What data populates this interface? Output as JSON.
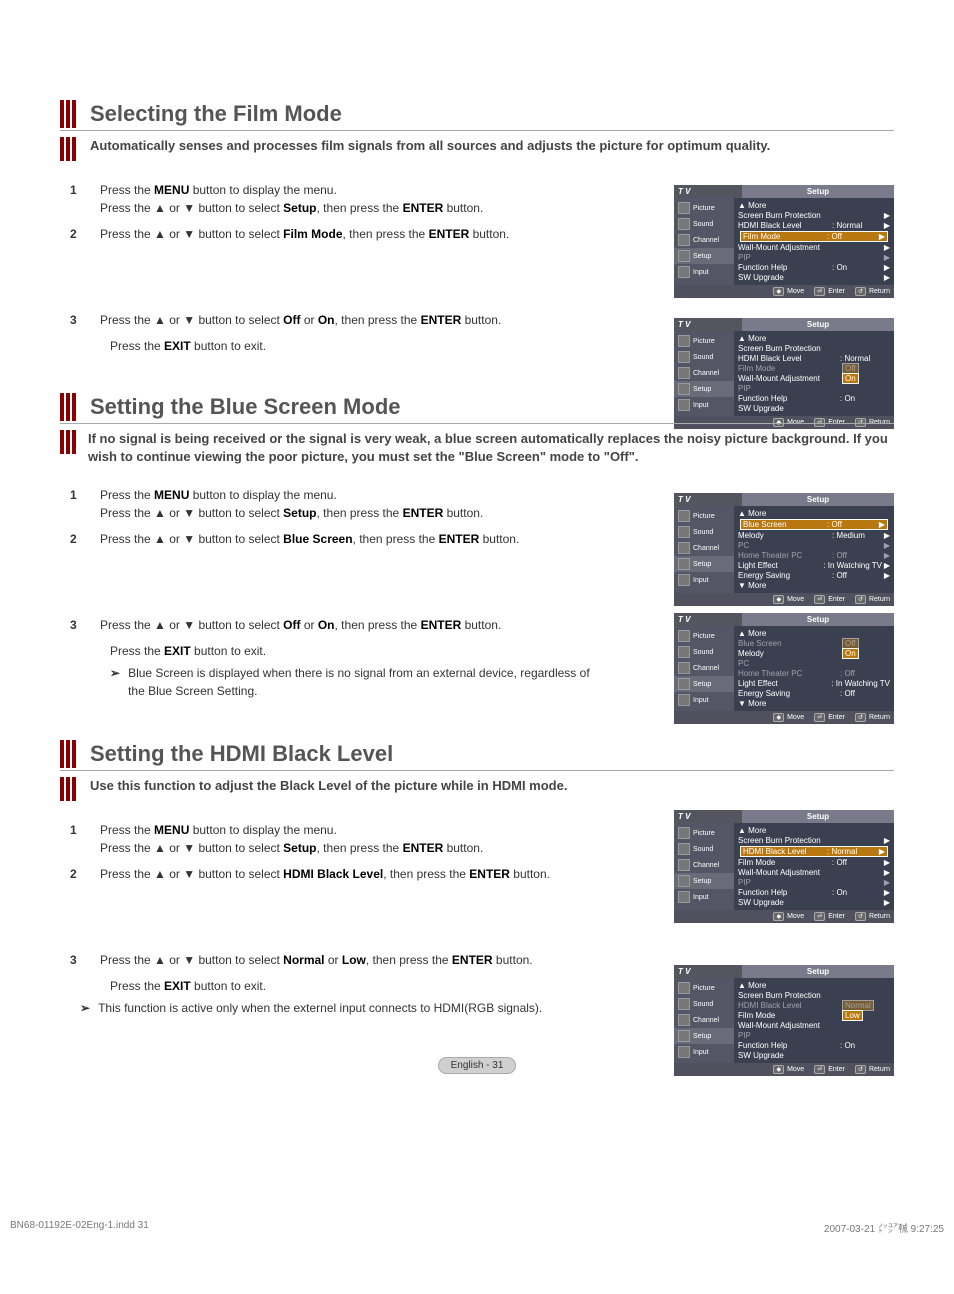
{
  "sec1": {
    "title": "Selecting the Film Mode",
    "subtitle": "Automatically senses and processes film signals from all sources and adjusts the picture for optimum quality.",
    "step1a": "Press the ",
    "step1a_b": "MENU",
    "step1a_c": " button to display the menu.",
    "step1b": "Press the ▲ or ▼ button to select ",
    "step1b_b": "Setup",
    "step1b_c": ", then press the ",
    "step1b_d": "ENTER",
    "step1b_e": " button.",
    "step2a": "Press the ▲ or ▼ button to select ",
    "step2a_b": "Film Mode",
    "step2a_c": ", then press the ",
    "step2a_d": "ENTER",
    "step2a_e": " button.",
    "step3a": "Press the ▲ or ▼ button to select ",
    "step3a_b": "Off",
    "step3a_c": " or ",
    "step3a_d": "On",
    "step3a_e": ", then press the ",
    "step3a_f": "ENTER",
    "step3a_g": " button.",
    "exit_a": "Press the ",
    "exit_b": "EXIT",
    "exit_c": " button to exit."
  },
  "sec2": {
    "title": "Setting the Blue Screen Mode",
    "subtitle": "If no signal is being received or the signal is very weak, a blue screen automatically replaces the noisy picture background. If you wish to continue viewing the poor picture, you must set the \"Blue Screen\" mode to \"Off\".",
    "step1a": "Press the ",
    "step1a_b": "MENU",
    "step1a_c": " button to display the menu.",
    "step1b": "Press the ▲ or ▼ button to select ",
    "step1b_b": "Setup",
    "step1b_c": ", then press the ",
    "step1b_d": "ENTER",
    "step1b_e": " button.",
    "step2a": "Press the ▲ or ▼ button to select ",
    "step2a_b": "Blue Screen",
    "step2a_c": ", then press the ",
    "step2a_d": "ENTER",
    "step2a_e": " button.",
    "step3a": "Press the ▲ or ▼ button to select ",
    "step3a_b": "Off",
    "step3a_c": " or ",
    "step3a_d": "On",
    "step3a_e": ", then press the ",
    "step3a_f": "ENTER",
    "step3a_g": " button.",
    "exit_a": "Press the ",
    "exit_b": "EXIT",
    "exit_c": " button to exit.",
    "note": "Blue Screen is displayed when there is no signal from an external device, regardless of the Blue Screen Setting."
  },
  "sec3": {
    "title": "Setting the HDMI Black Level",
    "subtitle": "Use this function to adjust the Black Level of the picture while in HDMI mode.",
    "step1a": "Press the ",
    "step1a_b": "MENU",
    "step1a_c": " button to display the menu.",
    "step1b": "Press the ▲ or ▼ button to select ",
    "step1b_b": "Setup",
    "step1b_c": ", then press the ",
    "step1b_d": "ENTER",
    "step1b_e": " button.",
    "step2a": "Press the ▲ or ▼ button to select ",
    "step2a_b": "HDMI Black Level",
    "step2a_c": ", then press the ",
    "step2a_d": "ENTER",
    "step2a_e": " button.",
    "step3a": "Press the ▲ or ▼ button to select ",
    "step3a_b": "Normal",
    "step3a_c": " or ",
    "step3a_d": "Low",
    "step3a_e": ", then press the ",
    "step3a_f": "ENTER",
    "step3a_g": " button.",
    "exit_a": "Press the ",
    "exit_b": "EXIT",
    "exit_c": " button to exit.",
    "note": "This function is active only when the externel input connects to HDMI(RGB signals)."
  },
  "osd": {
    "tv": "T V",
    "panel": "Setup",
    "side": {
      "picture": "Picture",
      "sound": "Sound",
      "channel": "Channel",
      "setup": "Setup",
      "input": "Input"
    },
    "more": "▲ More",
    "moredown": "▼ More",
    "sbp": "Screen Burn Protection",
    "hdmi": "HDMI Black Level",
    "normal": ": Normal",
    "filmmode": "Film Mode",
    "off": ": Off",
    "offv": "Off",
    "onv": "On",
    "wma": "Wall-Mount Adjustment",
    "pip": "PIP",
    "fh": "Function Help",
    "on": ": On",
    "swu": "SW Upgrade",
    "bluescreen": "Blue Screen",
    "melody": "Melody",
    "medium": ": Medium",
    "pc": "PC",
    "htpc": "Home Theater PC",
    "le": "Light Effect",
    "inwtv": ": In Watching TV",
    "es": "Energy Saving",
    "normalv": "Normal",
    "lowv": "Low",
    "foot_move": "Move",
    "foot_enter": "Enter",
    "foot_return": "Return"
  },
  "pagenum": "English - 31",
  "footer_l": "BN68-01192E-02Eng-1.indd   31",
  "footer_r": "2007-03-21   ㌩㍐㍻ 9:27:25"
}
